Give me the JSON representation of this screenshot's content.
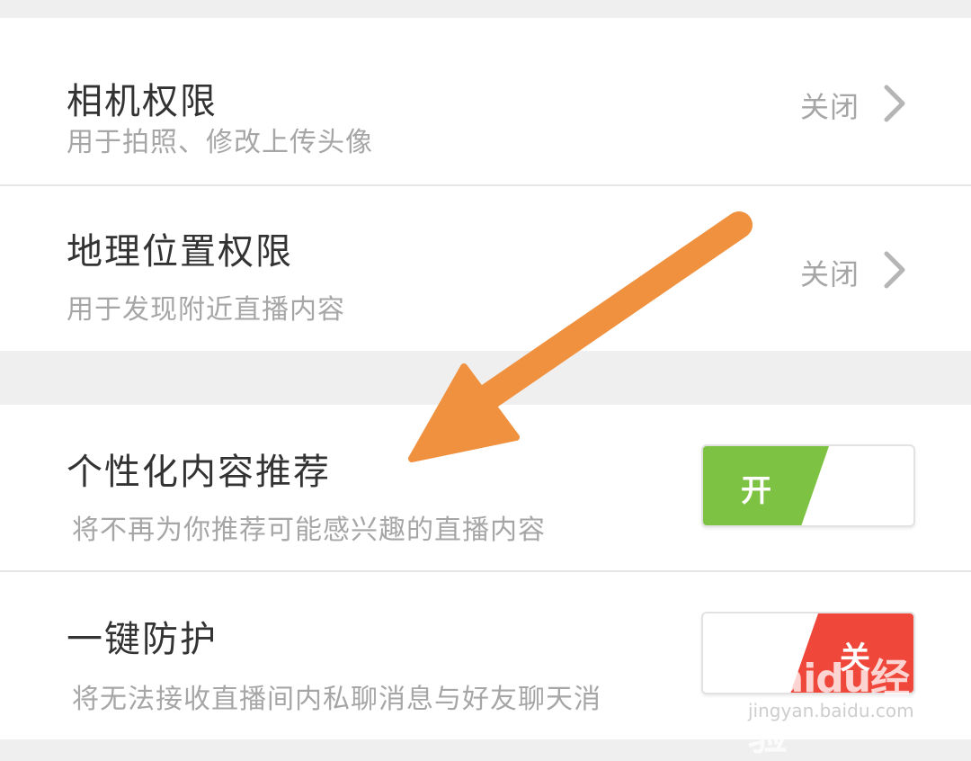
{
  "settings": {
    "camera": {
      "title": "相机权限",
      "subtitle": "用于拍照、修改上传头像",
      "status": "关闭"
    },
    "location": {
      "title": "地理位置权限",
      "subtitle": "用于发现附近直播内容",
      "status": "关闭"
    },
    "personalized": {
      "title": "个性化内容推荐",
      "subtitle": "将不再为你推荐可能感兴趣的直播内容",
      "toggle_label": "开",
      "toggle_on": true
    },
    "protection": {
      "title": "一键防护",
      "subtitle": "将无法接收直播间内私聊消息与好友聊天消",
      "toggle_label": "关",
      "toggle_on": false
    }
  },
  "colors": {
    "toggle_on": "#7dc242",
    "toggle_off": "#f0473b",
    "arrow": "#f0913f"
  },
  "icons": [
    "chevron-right-icon",
    "chevron-right-icon"
  ],
  "watermark": {
    "text": "Baidu经验",
    "url_text": "jingyan.baidu.com"
  }
}
